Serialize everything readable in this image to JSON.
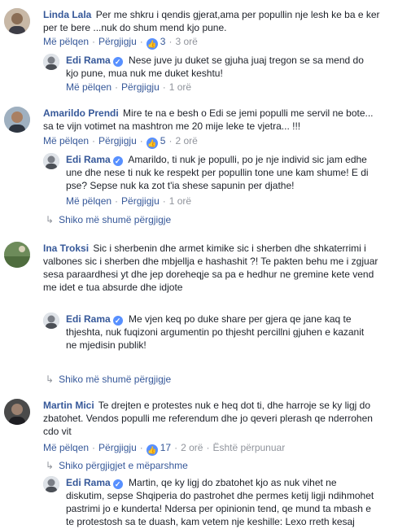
{
  "labels": {
    "like": "Më pëlqen",
    "reply": "Përgjigju",
    "edited": "Është përpunuar"
  },
  "comments": [
    {
      "author": "Linda Lala",
      "text": "Per me shkru i qendis gjerat,ama per popullin nje lesh ke ba e ker per te bere ...nuk do shum mend kjo pune.",
      "likes": "3",
      "time": "3 orë",
      "replies": [
        {
          "author": "Edi Rama",
          "verified": true,
          "text": "Nese juve ju duket se gjuha juaj tregon se sa mend do kjo pune, mua nuk me duket keshtu!",
          "time": "1 orë"
        }
      ]
    },
    {
      "author": "Amarildo Prendi",
      "text": "Mire te na e besh o Edi se jemi populli me servil ne bote... sa te vijn votimet na mashtron me 20 mije leke te vjetra... !!!",
      "likes": "5",
      "time": "2 orë",
      "replies": [
        {
          "author": "Edi Rama",
          "verified": true,
          "text": "Amarildo, ti nuk je populli, po je nje individ sic jam edhe une dhe nese ti nuk ke respekt per popullin tone une kam shume! E di pse? Sepse nuk ka zot t'ia shese sapunin per djathe!",
          "time": "1 orë"
        }
      ],
      "more_replies": "Shiko më shumë përgjigje"
    },
    {
      "author": "Ina Troksi",
      "text": "Sic i sherbenin dhe armet kimike sic i sherben dhe shkaterrimi i valbones sic i sherben dhe mbjellja e hashashit ?! Te pakten behu me i zgjuar sesa paraardhesi yt dhe jep doreheqje sa pa e hedhur ne gremine kete vend me idet e tua absurde dhe idjote",
      "replies": [
        {
          "author": "Edi Rama",
          "verified": true,
          "text": "Me vjen keq po duke share per gjera qe jane kaq te thjeshta, nuk fuqizoni argumentin po thjesht percillni gjuhen e kazanit ne mjedisin publik!"
        }
      ],
      "more_replies": "Shiko më shumë përgjigje"
    },
    {
      "author": "Martin Mici",
      "text": "Te drejten e protestes nuk e heq dot ti, dhe harroje se ky ligj do zbatohet. Vendos populli me referendum dhe jo qeveri plerash qe nderrohen cdo vit",
      "likes": "17",
      "time": "2 orë",
      "earlier_replies": "Shiko përgjigjet e mëparshme",
      "replies": [
        {
          "author": "Edi Rama",
          "verified": true,
          "text": "Martin, qe ky ligj do zbatohet kjo as nuk vihet ne diskutim, sepse Shqiperia do pastrohet dhe permes ketij ligji ndihmohet pastrimi jo e kunderta! Ndersa per opinionin tend, qe mund ta mbash e te protestosh sa te duash, kam vetem nje keshille: Lexo rreth kesaj"
        }
      ]
    }
  ],
  "colors": {
    "link": "#365899",
    "meta": "#90949c",
    "like_blue": "#5890ff",
    "text": "#1d2129"
  },
  "icons": [
    "thumbs-up-icon",
    "verified-badge-icon",
    "reply-arrow-icon"
  ]
}
